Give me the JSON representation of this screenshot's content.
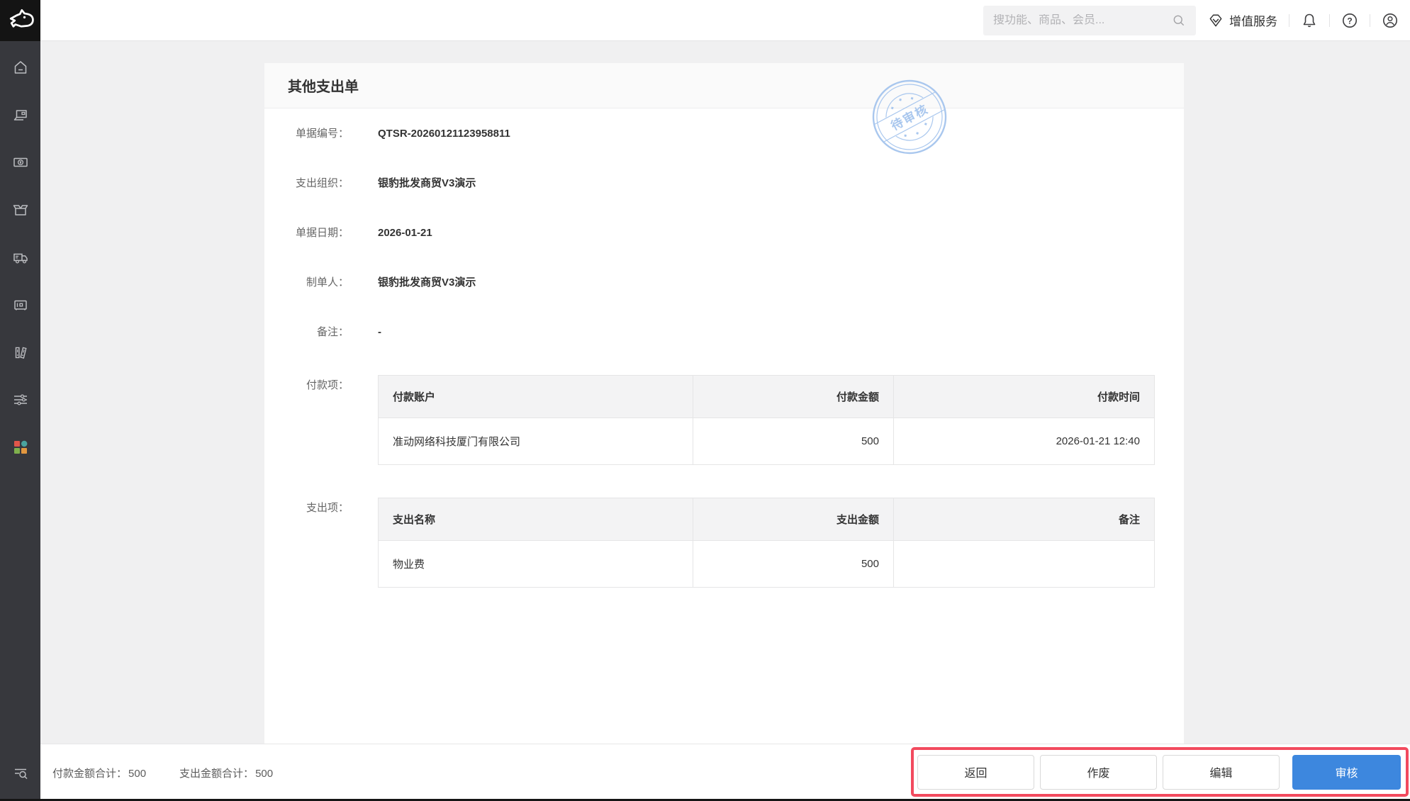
{
  "topbar": {
    "search_placeholder": "搜功能、商品、会员...",
    "vas_label": "增值服务",
    "icons": [
      "search-icon",
      "gem-icon",
      "bell-icon",
      "help-icon",
      "account-icon"
    ]
  },
  "sidebar": {
    "icons": [
      "home-icon",
      "pos-terminal-icon",
      "finance-icon",
      "products-icon",
      "delivery-icon",
      "hardware-icon",
      "ledger-icon",
      "settings-icon",
      "apps-icon",
      "find-function-icon"
    ],
    "apps_icon_colors": [
      "#e0564a",
      "#4aa39e",
      "#7fb04d",
      "#e2973f"
    ]
  },
  "page": {
    "title": "其他支出单",
    "stamp": "待审核",
    "fields": [
      {
        "label": "单据编号：",
        "value": "QTSR-20260121123958811"
      },
      {
        "label": "支出组织：",
        "value": "银豹批发商贸V3演示"
      },
      {
        "label": "单据日期：",
        "value": "2026-01-21"
      },
      {
        "label": "制单人：",
        "value": "银豹批发商贸V3演示"
      },
      {
        "label": "备注：",
        "value": "-"
      }
    ],
    "payment": {
      "label": "付款项：",
      "headers": [
        "付款账户",
        "付款金额",
        "付款时间"
      ],
      "rows": [
        [
          "准动网络科技厦门有限公司",
          "500",
          "2026-01-21 12:40"
        ]
      ]
    },
    "expense": {
      "label": "支出项：",
      "headers": [
        "支出名称",
        "支出金额",
        "备注"
      ],
      "rows": [
        [
          "物业费",
          "500",
          ""
        ]
      ]
    }
  },
  "footer": {
    "totals": [
      {
        "label": "付款金额合计：",
        "value": "500"
      },
      {
        "label": "支出金额合计：",
        "value": "500"
      }
    ],
    "buttons": [
      "返回",
      "作废",
      "编辑",
      "审核"
    ]
  },
  "colors": {
    "accent_blue": "#3d87de",
    "annotation_red": "#f24a5e",
    "stamp_blue": "#a9c7ee",
    "sidebar_bg": "#37383d",
    "logo_bg": "#141414"
  }
}
